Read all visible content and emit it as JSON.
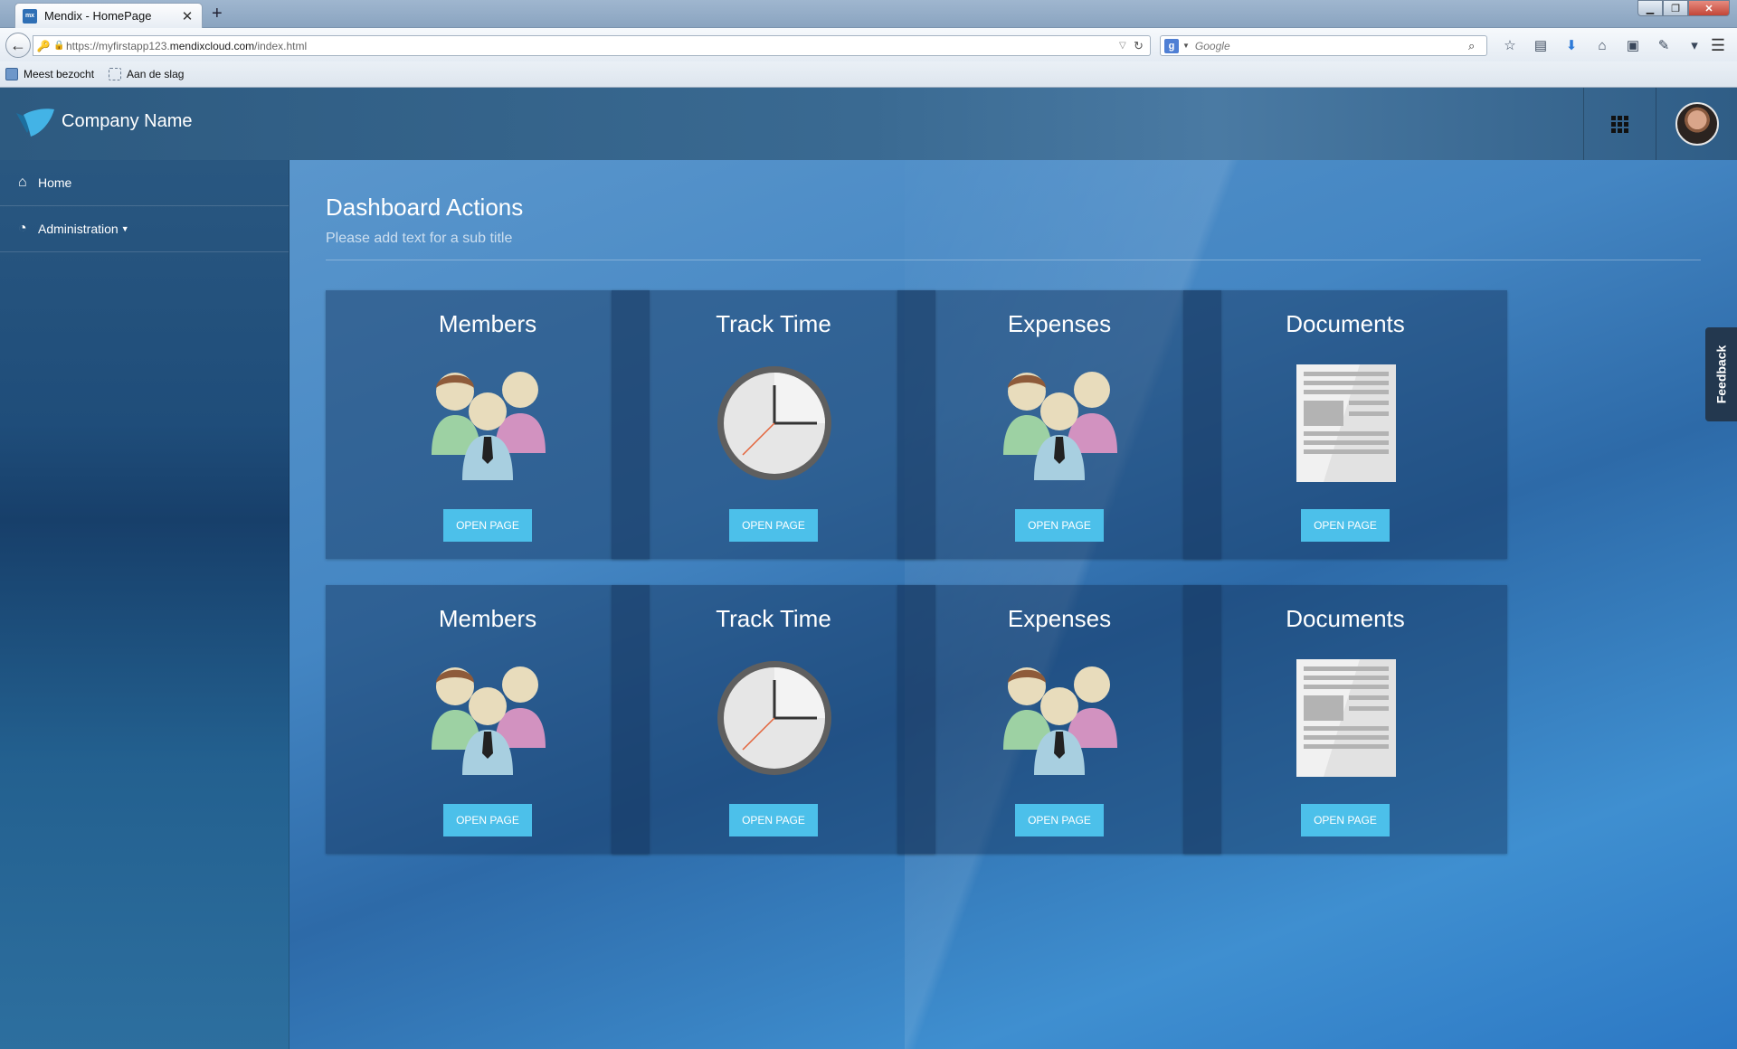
{
  "browser": {
    "tab_title": "Mendix - HomePage",
    "tab_favicon_text": "mx",
    "tab_close": "✕",
    "new_tab": "+",
    "url_host_prefix": "https://myfirstapp123.",
    "url_host_domain": "mendixcloud.com",
    "url_path": "/index.html",
    "search_engine_letter": "g",
    "search_placeholder": "Google",
    "bookmarks": [
      "Meest bezocht",
      "Aan de slag"
    ],
    "window_controls": {
      "minimize": "▁",
      "maximize": "❐",
      "close": "✕"
    }
  },
  "app": {
    "company_name": "Company Name",
    "sidebar": [
      {
        "label": "Home",
        "icon": "home-icon"
      },
      {
        "label": "Administration",
        "icon": "gauge-icon",
        "has_dropdown": true
      }
    ],
    "page_title": "Dashboard Actions",
    "page_subtitle": "Please add text for a sub title",
    "cards": [
      {
        "title": "Members",
        "icon": "users-icon",
        "button": "OPEN PAGE"
      },
      {
        "title": "Track Time",
        "icon": "clock-icon",
        "button": "OPEN PAGE"
      },
      {
        "title": "Expenses",
        "icon": "users-icon",
        "button": "OPEN PAGE"
      },
      {
        "title": "Documents",
        "icon": "document-icon",
        "button": "OPEN PAGE"
      },
      {
        "title": "Members",
        "icon": "users-icon",
        "button": "OPEN PAGE"
      },
      {
        "title": "Track Time",
        "icon": "clock-icon",
        "button": "OPEN PAGE"
      },
      {
        "title": "Expenses",
        "icon": "users-icon",
        "button": "OPEN PAGE"
      },
      {
        "title": "Documents",
        "icon": "document-icon",
        "button": "OPEN PAGE"
      }
    ],
    "feedback_label": "Feedback",
    "colors": {
      "button": "#4cc0ea",
      "topbar": "#3a6a92",
      "card_bg": "rgba(20,50,90,0.45)"
    }
  }
}
